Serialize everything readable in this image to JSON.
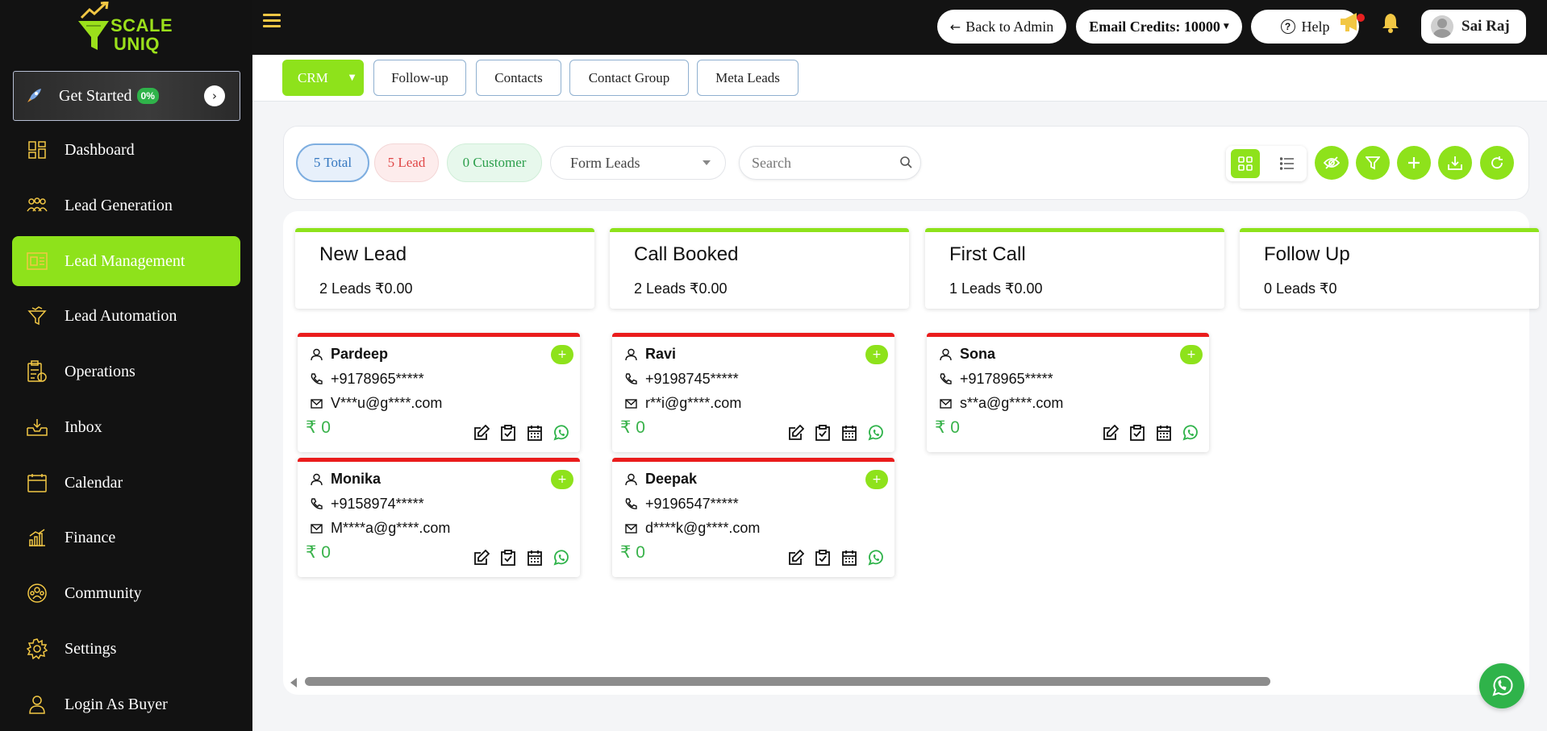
{
  "brand": {
    "line1": "SCALE",
    "line2": "UNIQ",
    "accent": "#8ee21b"
  },
  "get_started": {
    "label": "Get Started",
    "badge": "0%",
    "progress_percent": 0
  },
  "sidebar": {
    "items": [
      {
        "label": "Dashboard",
        "icon": "dashboard-icon"
      },
      {
        "label": "Lead Generation",
        "icon": "people-icon"
      },
      {
        "label": "Lead Management",
        "icon": "board-icon",
        "active": true
      },
      {
        "label": "Lead Automation",
        "icon": "funnel-icon"
      },
      {
        "label": "Operations",
        "icon": "clipboard-icon"
      },
      {
        "label": "Inbox",
        "icon": "inbox-icon"
      },
      {
        "label": "Calendar",
        "icon": "calendar-icon"
      },
      {
        "label": "Finance",
        "icon": "chart-icon"
      },
      {
        "label": "Community",
        "icon": "community-icon"
      },
      {
        "label": "Settings",
        "icon": "gear-icon"
      },
      {
        "label": "Login As Buyer",
        "icon": "user-icon"
      }
    ]
  },
  "topbar": {
    "back_label": "Back to Admin",
    "credits_label": "Email Credits: 10000",
    "help_label": "Help",
    "user_name": "Sai Raj"
  },
  "tabs": {
    "crm": "CRM",
    "followup": "Follow-up",
    "contacts": "Contacts",
    "contact_group": "Contact Group",
    "meta_leads": "Meta Leads"
  },
  "filters": {
    "total": "5 Total",
    "lead": "5 Lead",
    "customer": "0 Customer",
    "source_selected": "Form Leads",
    "search_placeholder": "Search"
  },
  "columns": [
    {
      "title": "New Lead",
      "summary": "2 Leads ₹0.00"
    },
    {
      "title": "Call Booked",
      "summary": "2 Leads ₹0.00"
    },
    {
      "title": "First Call",
      "summary": "1 Leads ₹0.00"
    },
    {
      "title": "Follow Up",
      "summary": "0 Leads ₹0"
    }
  ],
  "leads": [
    {
      "name": "Pardeep",
      "phone": "+9178965*****",
      "email": "V***u@g****.com",
      "amount": "₹ 0"
    },
    {
      "name": "Monika",
      "phone": "+9158974*****",
      "email": "M****a@g****.com",
      "amount": "₹ 0"
    },
    {
      "name": "Ravi",
      "phone": "+9198745*****",
      "email": "r**i@g****.com",
      "amount": "₹ 0"
    },
    {
      "name": "Deepak",
      "phone": "+9196547*****",
      "email": "d****k@g****.com",
      "amount": "₹ 0"
    },
    {
      "name": "Sona",
      "phone": "+9178965*****",
      "email": "s**a@g****.com",
      "amount": "₹ 0"
    }
  ],
  "card_plus": "+"
}
